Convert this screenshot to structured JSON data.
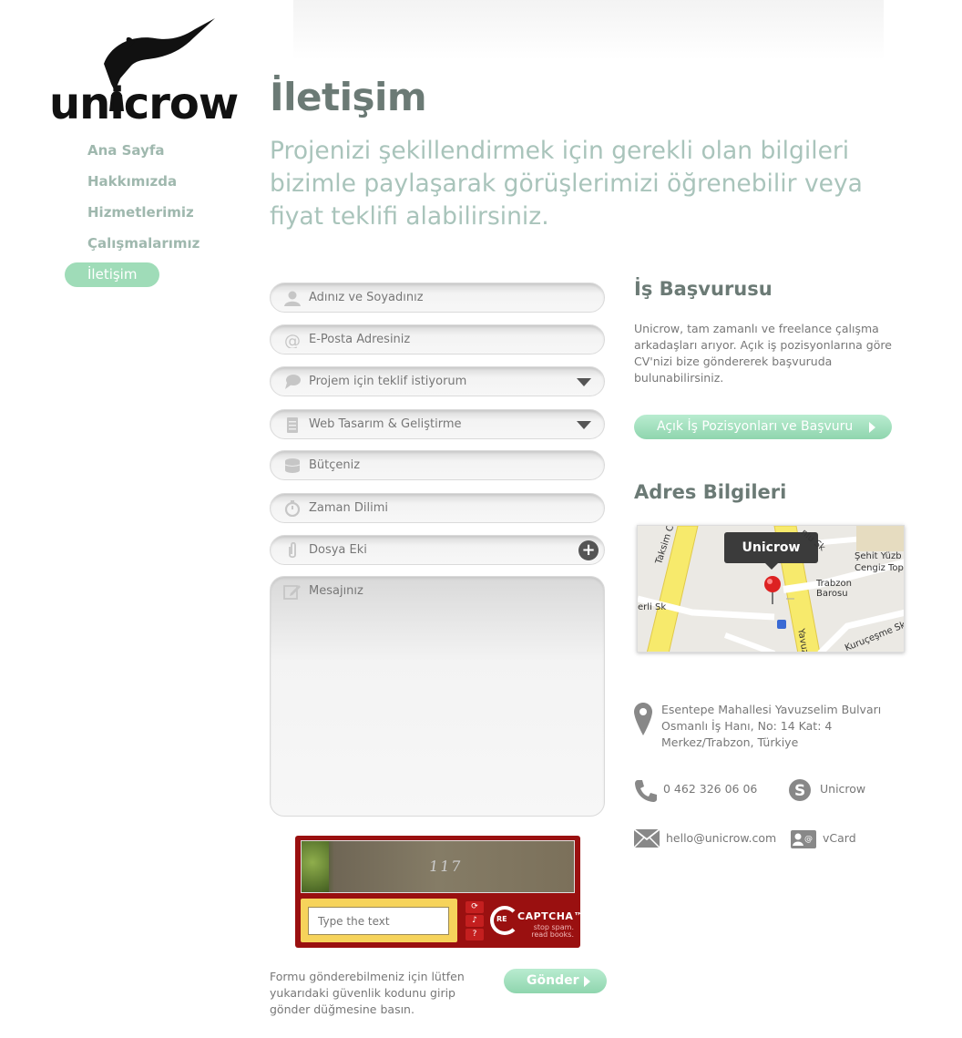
{
  "logo": {
    "text": "unicrow"
  },
  "nav": {
    "items": [
      {
        "label": "Ana Sayfa"
      },
      {
        "label": "Hakkımızda"
      },
      {
        "label": "Hizmetlerimiz"
      },
      {
        "label": "Çalışmalarımız"
      },
      {
        "label": "İletişim",
        "active": true
      }
    ]
  },
  "page": {
    "title": "İletişim",
    "intro": "Projenizi şekillendirmek için gerekli olan bilgileri bizimle paylaşarak görüşlerimizi öğrenebilir veya fiyat teklifi alabilirsiniz."
  },
  "form": {
    "name": "Adınız ve Soyadınız",
    "email": "E-Posta Adresiniz",
    "request_select": "Projem için teklif istiyorum",
    "service_select": "Web Tasarım & Geliştirme",
    "budget": "Bütçeniz",
    "timeframe": "Zaman Dilimi",
    "attachment": "Dosya Eki",
    "message": "Mesajınız",
    "note": "Formu gönderebilmeniz için lütfen yukarıdaki güvenlik kodunu girip gönder düğmesine basın.",
    "submit_label": "Gönder"
  },
  "captcha": {
    "code_text": "117",
    "input_placeholder": "Type the text",
    "brand_prefix": "RE",
    "brand": "CAPTCHA™",
    "tagline_1": "stop spam.",
    "tagline_2": "read books."
  },
  "job": {
    "title": "İş Başvurusu",
    "text": "Unicrow, tam zamanlı ve freelance çalışma arkadaşları arıyor. Açık iş pozisyonlarına göre CV'nizi bize göndererek başvuruda bulunabilirsiniz.",
    "button_label": "Açık İş Pozisyonları ve Başvuru"
  },
  "address": {
    "title": "Adres Bilgileri",
    "map": {
      "tooltip": "Unicrow",
      "labels": [
        "Taksim Cd",
        "Şehit Yüzb",
        "Cengiz Tope",
        "Trabzon",
        "Barosu",
        "Kuruçeşme Sk",
        "erli Sk",
        "Yavuz",
        "nlu Sk"
      ]
    },
    "line1": "Esentepe Mahallesi Yavuzselim Bulvarı",
    "line2": "Osmanlı İş Hanı, No: 14 Kat: 4",
    "line3": "Merkez/Trabzon, Türkiye",
    "phone": "0 462 326 06 06",
    "skype": "Unicrow",
    "email": "hello@unicrow.com",
    "vcard": "vCard"
  },
  "colors": {
    "accent_green": "#9fdcb8",
    "nav_text": "#9fb8ae",
    "intro_text": "#a9c4bb",
    "captcha_red": "#9a1010",
    "captcha_yellow": "#f6d35b"
  }
}
